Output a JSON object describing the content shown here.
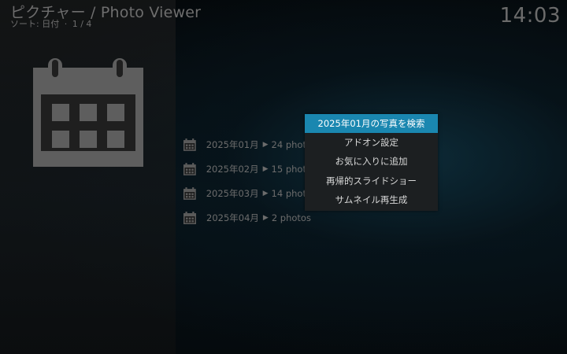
{
  "header": {
    "title": "ピクチャー / Photo Viewer",
    "sort_label": "ソート: 日付",
    "separator": "·",
    "page": "1 / 4"
  },
  "clock": "14:03",
  "folder_icon": "calendar-icon",
  "list": [
    {
      "label": "2025年01月",
      "count": "24 photos"
    },
    {
      "label": "2025年02月",
      "count": "15 photos"
    },
    {
      "label": "2025年03月",
      "count": "14 photos"
    },
    {
      "label": "2025年04月",
      "count": "2 photos"
    }
  ],
  "context_menu": {
    "selected_index": 0,
    "items": [
      "2025年01月の写真を検索",
      "アドオン設定",
      "お気に入りに追加",
      "再帰的スライドショー",
      "サムネイル再生成"
    ]
  },
  "colors": {
    "highlight": "#1a87b0",
    "text_dim": "#6c6c6c",
    "menu_bg": "#1c1f21"
  }
}
